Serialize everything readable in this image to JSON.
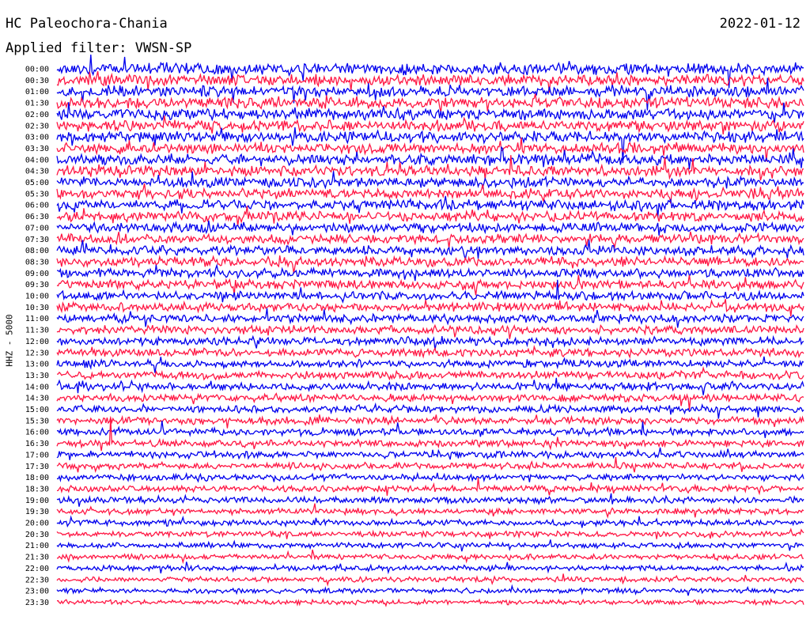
{
  "header": {
    "station": "HC Paleochora-Chania",
    "date": "2022-01-12",
    "filter": "Applied filter: VWSN-SP"
  },
  "chart_data": {
    "type": "line",
    "title": "HC Paleochora-Chania",
    "date": "2022-01-12",
    "filter_label": "Applied filter: VWSN-SP",
    "ylabel": "HHZ - 5000",
    "xlabel": "",
    "row_labels": [
      "00:00",
      "00:30",
      "01:00",
      "01:30",
      "02:00",
      "02:30",
      "03:00",
      "03:30",
      "04:00",
      "04:30",
      "05:00",
      "05:30",
      "06:00",
      "06:30",
      "07:00",
      "07:30",
      "08:00",
      "08:30",
      "09:00",
      "09:30",
      "10:00",
      "10:30",
      "11:00",
      "11:30",
      "12:00",
      "12:30",
      "13:00",
      "13:30",
      "14:00",
      "14:30",
      "15:00",
      "15:30",
      "16:00",
      "16:30",
      "17:00",
      "17:30",
      "18:00",
      "18:30",
      "19:00",
      "19:30",
      "20:00",
      "20:30",
      "21:00",
      "21:30",
      "22:00",
      "22:30",
      "23:00",
      "23:30"
    ],
    "series_colors": [
      "#0000ee",
      "#ff1744"
    ],
    "grid": false,
    "legend": "none"
  }
}
